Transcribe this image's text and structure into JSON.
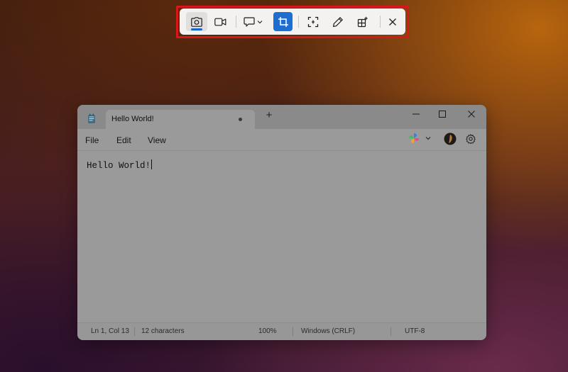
{
  "snipping_toolbar": {
    "buttons": [
      {
        "name": "snip-mode",
        "icon": "camera-icon",
        "state": "selected"
      },
      {
        "name": "record-mode",
        "icon": "video-icon"
      },
      {
        "name": "shape-select",
        "icon": "rectangle-shape-icon",
        "has_dropdown": true
      },
      {
        "name": "crop",
        "icon": "crop-icon",
        "state": "active",
        "accent": "#1c6fd1"
      },
      {
        "name": "text-actions",
        "icon": "text-actions-icon"
      },
      {
        "name": "edit",
        "icon": "pen-icon"
      },
      {
        "name": "more-tools",
        "icon": "add-grid-icon"
      },
      {
        "name": "close",
        "icon": "close-icon"
      }
    ],
    "highlight_color": "#d8171d"
  },
  "notepad": {
    "app_icon": "notepad-icon",
    "tab_title": "Hello World!",
    "tab_modified": true,
    "new_tab_label": "+",
    "menu": [
      "File",
      "Edit",
      "View"
    ],
    "menu_right_icons": [
      "copilot-icon",
      "chevron-down-icon",
      "profile-avatar",
      "gear-icon"
    ],
    "content": "Hello World!",
    "status": {
      "position": "Ln 1, Col 13",
      "characters": "12 characters",
      "zoom": "100%",
      "line_ending": "Windows (CRLF)",
      "encoding": "UTF-8"
    }
  }
}
